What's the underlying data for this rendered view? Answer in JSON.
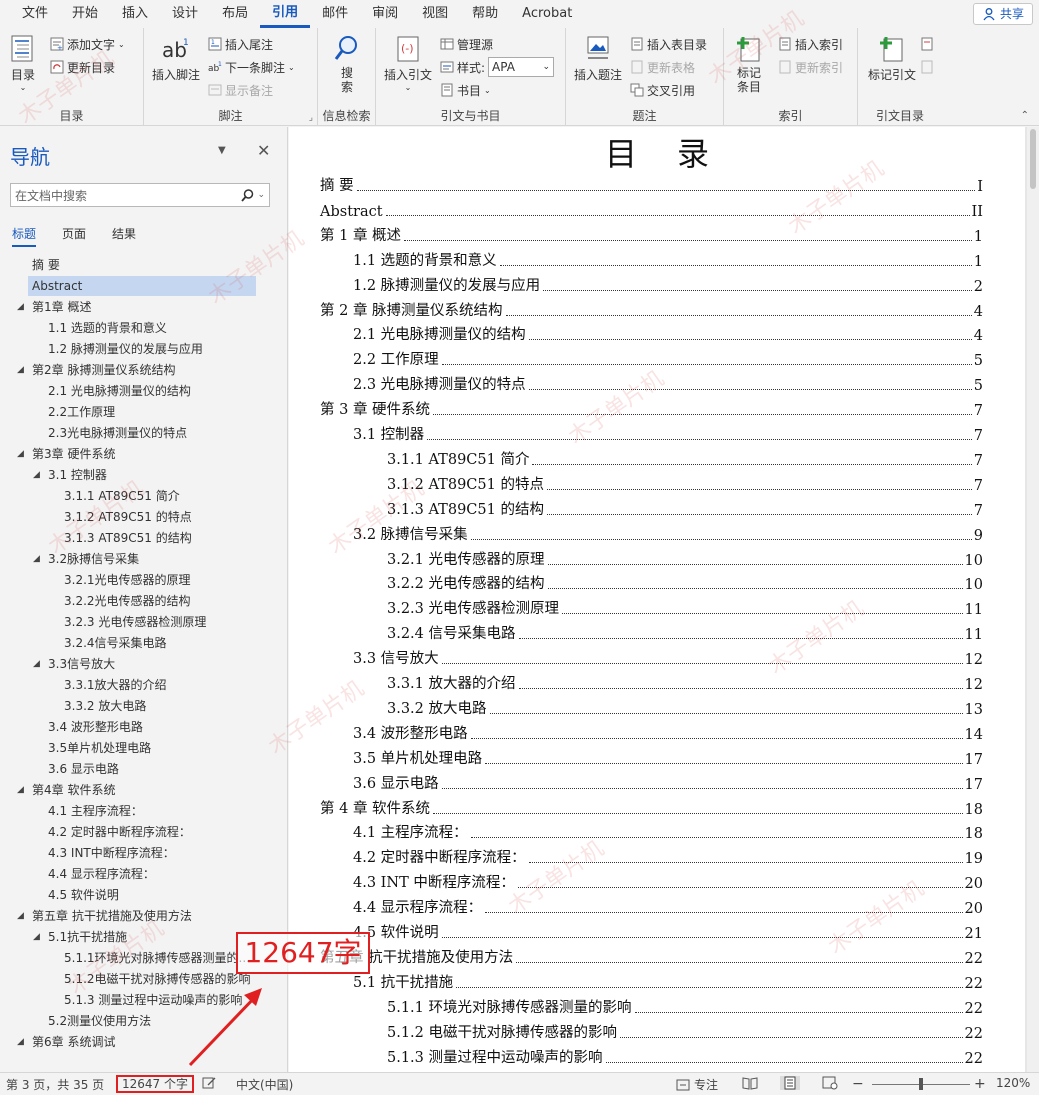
{
  "menubar": {
    "items": [
      "文件",
      "开始",
      "插入",
      "设计",
      "布局",
      "引用",
      "邮件",
      "审阅",
      "视图",
      "帮助",
      "Acrobat"
    ],
    "active": "引用",
    "share_label": "共享"
  },
  "ribbon": {
    "groups": {
      "toc": {
        "label": "目录",
        "toc_button": "目录",
        "add_text": "添加文字",
        "update_toc": "更新目录"
      },
      "footnotes": {
        "label": "脚注",
        "insert_footnote": "插入脚注",
        "insert_endnote": "插入尾注",
        "next_footnote": "下一条脚注",
        "show_notes": "显示备注"
      },
      "research": {
        "label": "信息检索",
        "search": "搜\n索"
      },
      "citations": {
        "label": "引文与书目",
        "insert_citation": "插入引文",
        "manage_sources": "管理源",
        "style_label": "样式:",
        "style_value": "APA",
        "bibliography": "书目"
      },
      "captions": {
        "label": "题注",
        "insert_caption": "插入题注",
        "insert_table_of_figures": "插入表目录",
        "update_table": "更新表格",
        "cross_reference": "交叉引用"
      },
      "index": {
        "label": "索引",
        "mark_entry": "标记\n条目",
        "insert_index": "插入索引",
        "update_index": "更新索引"
      },
      "toa": {
        "label": "引文目录",
        "mark_citation": "标记引文"
      }
    }
  },
  "nav": {
    "title": "导航",
    "search_placeholder": "在文档中搜索",
    "tabs": [
      "标题",
      "页面",
      "结果"
    ],
    "active_tab": "标题",
    "tree": [
      {
        "text": "摘    要",
        "level": 1,
        "expand": false
      },
      {
        "text": "Abstract",
        "level": 1,
        "expand": false,
        "selected": true
      },
      {
        "text": "第1章 概述",
        "level": 1,
        "expand": true
      },
      {
        "text": "1.1 选题的背景和意义",
        "level": 2,
        "expand": false
      },
      {
        "text": "1.2 脉搏测量仪的发展与应用",
        "level": 2,
        "expand": false
      },
      {
        "text": "第2章 脉搏测量仪系统结构",
        "level": 1,
        "expand": true
      },
      {
        "text": "2.1 光电脉搏测量仪的结构",
        "level": 2,
        "expand": false
      },
      {
        "text": "2.2工作原理",
        "level": 2,
        "expand": false
      },
      {
        "text": "2.3光电脉搏测量仪的特点",
        "level": 2,
        "expand": false
      },
      {
        "text": "第3章 硬件系统",
        "level": 1,
        "expand": true
      },
      {
        "text": "3.1 控制器",
        "level": 2,
        "expand": true
      },
      {
        "text": "3.1.1 AT89C51 简介",
        "level": 3,
        "expand": false
      },
      {
        "text": "3.1.2 AT89C51 的特点",
        "level": 3,
        "expand": false
      },
      {
        "text": "3.1.3 AT89C51 的结构",
        "level": 3,
        "expand": false
      },
      {
        "text": "3.2脉搏信号采集",
        "level": 2,
        "expand": true
      },
      {
        "text": "3.2.1光电传感器的原理",
        "level": 3,
        "expand": false
      },
      {
        "text": "3.2.2光电传感器的结构",
        "level": 3,
        "expand": false
      },
      {
        "text": "3.2.3 光电传感器检测原理",
        "level": 3,
        "expand": false
      },
      {
        "text": "3.2.4信号采集电路",
        "level": 3,
        "expand": false
      },
      {
        "text": "3.3信号放大",
        "level": 2,
        "expand": true
      },
      {
        "text": "3.3.1放大器的介绍",
        "level": 3,
        "expand": false
      },
      {
        "text": "3.3.2 放大电路",
        "level": 3,
        "expand": false
      },
      {
        "text": "3.4 波形整形电路",
        "level": 2,
        "expand": false
      },
      {
        "text": "3.5单片机处理电路",
        "level": 2,
        "expand": false
      },
      {
        "text": "3.6 显示电路",
        "level": 2,
        "expand": false
      },
      {
        "text": "第4章 软件系统",
        "level": 1,
        "expand": true
      },
      {
        "text": "4.1 主程序流程：",
        "level": 2,
        "expand": false
      },
      {
        "text": "4.2 定时器中断程序流程：",
        "level": 2,
        "expand": false
      },
      {
        "text": "4.3 INT中断程序流程：",
        "level": 2,
        "expand": false
      },
      {
        "text": "4.4 显示程序流程：",
        "level": 2,
        "expand": false
      },
      {
        "text": "4.5 软件说明",
        "level": 2,
        "expand": false
      },
      {
        "text": "第五章 抗干扰措施及使用方法",
        "level": 1,
        "expand": true
      },
      {
        "text": "5.1抗干扰措施",
        "level": 2,
        "expand": true
      },
      {
        "text": "5.1.1环境光对脉搏传感器测量的...",
        "level": 3,
        "expand": false
      },
      {
        "text": "5.1.2电磁干扰对脉搏传感器的影响",
        "level": 3,
        "expand": false
      },
      {
        "text": "5.1.3 测量过程中运动噪声的影响",
        "level": 3,
        "expand": false
      },
      {
        "text": "5.2测量仪使用方法",
        "level": 2,
        "expand": false
      },
      {
        "text": "第6章 系统调试",
        "level": 1,
        "expand": true
      }
    ]
  },
  "document": {
    "title": "目录",
    "toc": [
      {
        "label": "摘    要",
        "page": "I",
        "level": 0
      },
      {
        "label": "Abstract",
        "page": "II",
        "level": 0
      },
      {
        "label": "第 1 章  概述",
        "page": "1",
        "level": 0
      },
      {
        "label": "1.1  选题的背景和意义",
        "page": "1",
        "level": 1
      },
      {
        "label": "1.2  脉搏测量仪的发展与应用",
        "page": "2",
        "level": 1
      },
      {
        "label": "第 2 章  脉搏测量仪系统结构",
        "page": "4",
        "level": 0
      },
      {
        "label": "2.1  光电脉搏测量仪的结构",
        "page": "4",
        "level": 1
      },
      {
        "label": "2.2 工作原理",
        "page": "5",
        "level": 1
      },
      {
        "label": "2.3 光电脉搏测量仪的特点",
        "page": "5",
        "level": 1
      },
      {
        "label": "第 3 章  硬件系统",
        "page": "7",
        "level": 0
      },
      {
        "label": "3.1  控制器",
        "page": "7",
        "level": 1
      },
      {
        "label": "3.1.1 AT89C51  简介",
        "page": "7",
        "level": 2
      },
      {
        "label": "3.1.2 AT89C51  的特点",
        "page": "7",
        "level": 2
      },
      {
        "label": "3.1.3 AT89C51  的结构",
        "page": "7",
        "level": 2
      },
      {
        "label": "3.2 脉搏信号采集",
        "page": "9",
        "level": 1
      },
      {
        "label": "3.2.1 光电传感器的原理",
        "page": "10",
        "level": 2
      },
      {
        "label": "3.2.2 光电传感器的结构",
        "page": "10",
        "level": 2
      },
      {
        "label": "3.2.3  光电传感器检测原理",
        "page": "11",
        "level": 2
      },
      {
        "label": "3.2.4 信号采集电路",
        "page": "11",
        "level": 2
      },
      {
        "label": "3.3 信号放大",
        "page": "12",
        "level": 1
      },
      {
        "label": "3.3.1 放大器的介绍",
        "page": "12",
        "level": 2
      },
      {
        "label": "3.3.2  放大电路",
        "page": "13",
        "level": 2
      },
      {
        "label": "3.4  波形整形电路",
        "page": "14",
        "level": 1
      },
      {
        "label": "3.5 单片机处理电路",
        "page": "17",
        "level": 1
      },
      {
        "label": "3.6  显示电路",
        "page": "17",
        "level": 1
      },
      {
        "label": "第 4 章  软件系统",
        "page": "18",
        "level": 0
      },
      {
        "label": "4.1  主程序流程：",
        "page": "18",
        "level": 1
      },
      {
        "label": "4.2  定时器中断程序流程：",
        "page": "19",
        "level": 1
      },
      {
        "label": "4.3 INT 中断程序流程：",
        "page": "20",
        "level": 1
      },
      {
        "label": "4.4  显示程序流程：",
        "page": "20",
        "level": 1
      },
      {
        "label": "4.5  软件说明",
        "page": "21",
        "level": 1
      },
      {
        "label": "第五章  抗干扰措施及使用方法",
        "page": "22",
        "level": 0
      },
      {
        "label": "5.1 抗干扰措施",
        "page": "22",
        "level": 1
      },
      {
        "label": "5.1.1 环境光对脉搏传感器测量的影响",
        "page": "22",
        "level": 2
      },
      {
        "label": "5.1.2 电磁干扰对脉搏传感器的影响",
        "page": "22",
        "level": 2
      },
      {
        "label": "5.1.3  测量过程中运动噪声的影响",
        "page": "22",
        "level": 2
      }
    ]
  },
  "watermark": "木子单片机",
  "annotation": {
    "label": "12647字",
    "color": "#e02020"
  },
  "statusbar": {
    "page_info": "第 3 页，共 35 页",
    "word_count": "12647 个字",
    "language": "中文(中国)",
    "focus": "专注",
    "zoom": "120%",
    "zoom_minus": "−",
    "zoom_plus": "+"
  },
  "colors": {
    "accent": "#185abd",
    "selection": "#c5d7f0",
    "annotation": "#e02020"
  }
}
